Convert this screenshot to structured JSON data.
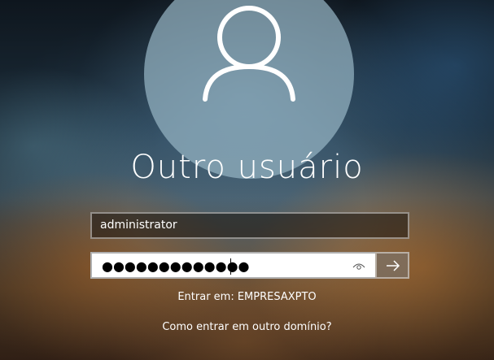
{
  "user": {
    "display_name": "Outro usuário"
  },
  "username_field": {
    "value": "administrator"
  },
  "password_field": {
    "masked_value": "●●●●●●●●●●●●●"
  },
  "sign_in_to": "Entrar em: EMPRESAXPTO",
  "other_domain_link": "Como entrar em outro domínio?",
  "icons": {
    "avatar": "user-silhouette-icon",
    "reveal": "eye-icon",
    "submit": "arrow-right-icon"
  },
  "colors": {
    "text": "#ffffff",
    "password_bg": "#ffffff"
  }
}
